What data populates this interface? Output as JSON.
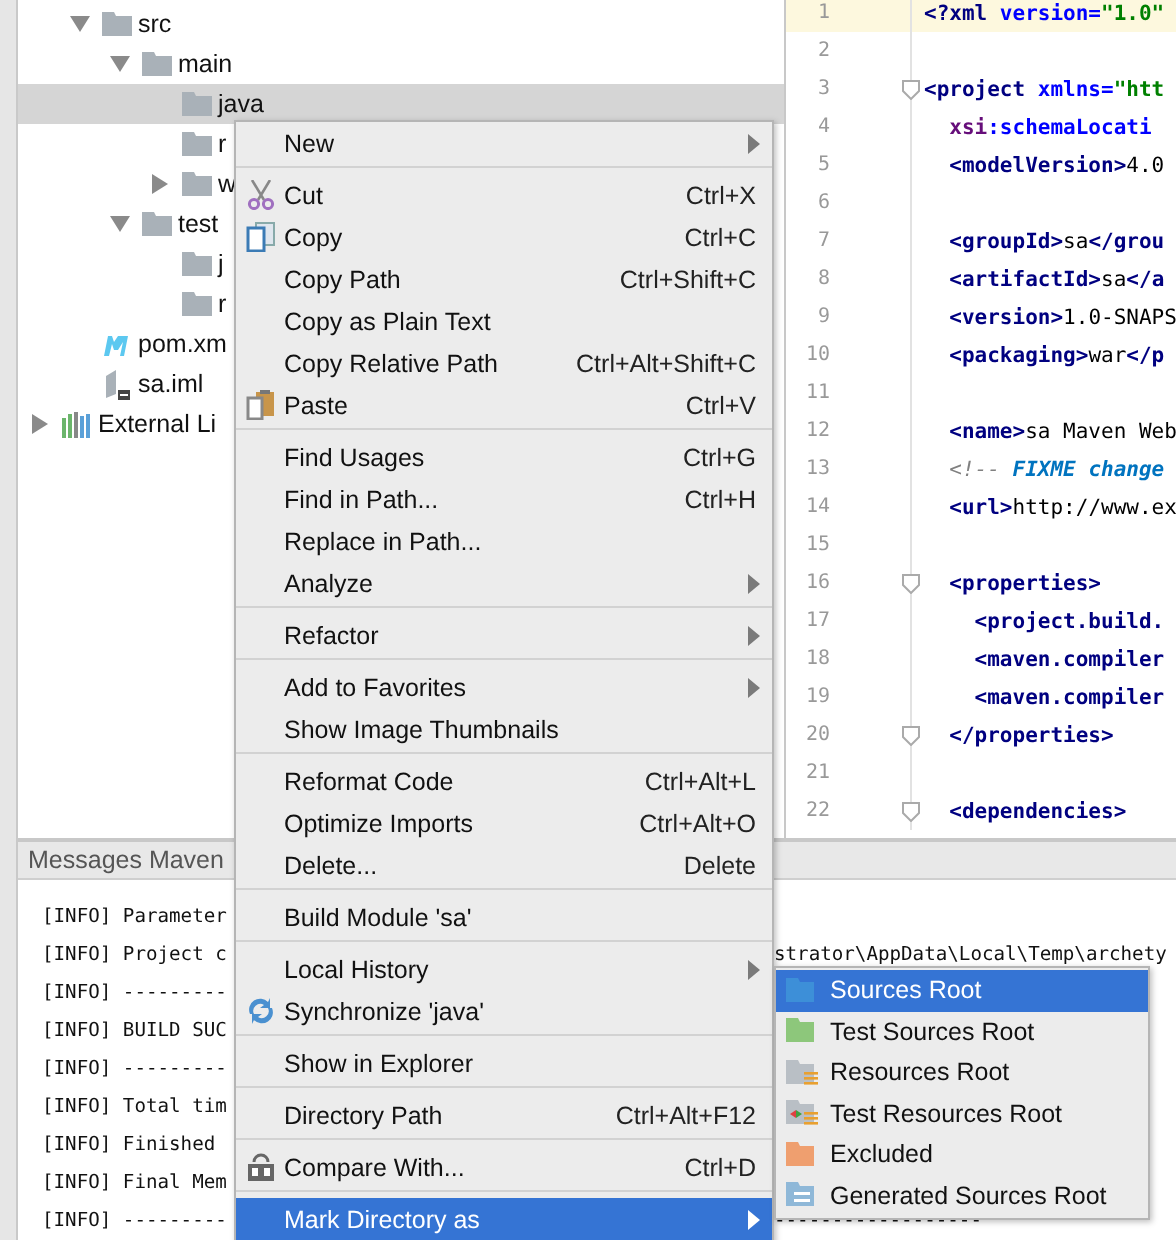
{
  "tree": {
    "items": [
      {
        "label": "src",
        "kind": "folder",
        "expanded": true,
        "selected": false,
        "children": [
          {
            "label": "main",
            "kind": "folder",
            "expanded": true,
            "selected": false,
            "children": [
              {
                "label": "java",
                "kind": "folder",
                "selected": true
              },
              {
                "label": "r",
                "kind": "folder",
                "selected": false
              },
              {
                "label": "w",
                "kind": "folder",
                "expanded": false,
                "selected": false
              }
            ]
          },
          {
            "label": "test",
            "kind": "folder",
            "expanded": true,
            "selected": false,
            "children": [
              {
                "label": "j",
                "kind": "folder",
                "selected": false
              },
              {
                "label": "r",
                "kind": "folder",
                "selected": false
              }
            ]
          }
        ]
      },
      {
        "label": "pom.xm",
        "kind": "maven",
        "selected": false
      },
      {
        "label": "sa.iml",
        "kind": "module",
        "selected": false
      }
    ],
    "root_items": [
      {
        "label": "External Li",
        "kind": "library",
        "expanded": false,
        "selected": false
      }
    ]
  },
  "editor": {
    "lines": [
      {
        "number": "1",
        "current": true,
        "fold": false,
        "segments": [
          {
            "text": "<?xml",
            "kind": "tag"
          },
          {
            "text": " version=",
            "kind": "attr"
          },
          {
            "text": "\"1.0\"",
            "kind": "string"
          }
        ]
      },
      {
        "number": "2",
        "current": false,
        "fold": false
      },
      {
        "number": "3",
        "current": false,
        "fold": true,
        "segments": [
          {
            "text": "<project",
            "kind": "tag"
          },
          {
            "text": " xmlns=",
            "kind": "attr"
          },
          {
            "text": "\"htt",
            "kind": "string"
          }
        ]
      },
      {
        "number": "4",
        "current": false,
        "fold": false,
        "segments": [
          {
            "text": "  xsi",
            "kind": "ns"
          },
          {
            "text": ":schemaLocati",
            "kind": "attr"
          }
        ]
      },
      {
        "number": "5",
        "current": false,
        "fold": false,
        "segments": [
          {
            "text": "  <modelVersion>",
            "kind": "tag"
          },
          {
            "text": "4.0",
            "kind": "text"
          }
        ]
      },
      {
        "number": "6",
        "current": false,
        "fold": false
      },
      {
        "number": "7",
        "current": false,
        "fold": false,
        "segments": [
          {
            "text": "  <groupId>",
            "kind": "tag"
          },
          {
            "text": "sa",
            "kind": "text"
          },
          {
            "text": "</grou",
            "kind": "tag"
          }
        ]
      },
      {
        "number": "8",
        "current": false,
        "fold": false,
        "segments": [
          {
            "text": "  <artifactId>",
            "kind": "tag"
          },
          {
            "text": "sa",
            "kind": "text"
          },
          {
            "text": "</a",
            "kind": "tag"
          }
        ]
      },
      {
        "number": "9",
        "current": false,
        "fold": false,
        "segments": [
          {
            "text": "  <version>",
            "kind": "tag"
          },
          {
            "text": "1.0-SNAPS",
            "kind": "text"
          }
        ]
      },
      {
        "number": "10",
        "current": false,
        "fold": false,
        "segments": [
          {
            "text": "  <packaging>",
            "kind": "tag"
          },
          {
            "text": "war",
            "kind": "text"
          },
          {
            "text": "</p",
            "kind": "tag"
          }
        ]
      },
      {
        "number": "11",
        "current": false,
        "fold": false
      },
      {
        "number": "12",
        "current": false,
        "fold": false,
        "segments": [
          {
            "text": "  <name>",
            "kind": "tag"
          },
          {
            "text": "sa Maven Web",
            "kind": "text"
          }
        ]
      },
      {
        "number": "13",
        "current": false,
        "fold": false,
        "segments": [
          {
            "text": "  <!-- ",
            "kind": "comment"
          },
          {
            "text": "FIXME change",
            "kind": "todo"
          }
        ]
      },
      {
        "number": "14",
        "current": false,
        "fold": false,
        "segments": [
          {
            "text": "  <url>",
            "kind": "tag"
          },
          {
            "text": "http://www.ex",
            "kind": "text"
          }
        ]
      },
      {
        "number": "15",
        "current": false,
        "fold": false
      },
      {
        "number": "16",
        "current": false,
        "fold": true,
        "segments": [
          {
            "text": "  <properties>",
            "kind": "tag"
          }
        ]
      },
      {
        "number": "17",
        "current": false,
        "fold": false,
        "segments": [
          {
            "text": "    <project.build.",
            "kind": "tag"
          }
        ]
      },
      {
        "number": "18",
        "current": false,
        "fold": false,
        "segments": [
          {
            "text": "    <maven.compiler",
            "kind": "tag"
          }
        ]
      },
      {
        "number": "19",
        "current": false,
        "fold": false,
        "segments": [
          {
            "text": "    <maven.compiler",
            "kind": "tag"
          }
        ]
      },
      {
        "number": "20",
        "current": false,
        "fold": true,
        "segments": [
          {
            "text": "  </properties>",
            "kind": "tag"
          }
        ]
      },
      {
        "number": "21",
        "current": false,
        "fold": false
      },
      {
        "number": "22",
        "current": false,
        "fold": true,
        "segments": [
          {
            "text": "  <dependencies>",
            "kind": "tag"
          }
        ]
      }
    ]
  },
  "bottom_panel": {
    "tab": "Messages Maven",
    "lines": [
      {
        "text": "[INFO] Parameter"
      },
      {
        "text": "[INFO] Project c",
        "tail": "strator\\AppData\\Local\\Temp\\archety"
      },
      {
        "text": "[INFO] ---------"
      },
      {
        "text": "[INFO] BUILD SUC"
      },
      {
        "text": "[INFO] ---------"
      },
      {
        "text": "[INFO] Total tim"
      },
      {
        "text": "[INFO] Finished"
      },
      {
        "text": "[INFO] Final Mem"
      },
      {
        "text": "[INFO] ---------",
        "tail": "------------------"
      }
    ]
  },
  "context_menu": {
    "groups": [
      [
        {
          "label": "New",
          "has_submenu": true,
          "selected": false
        }
      ],
      [
        {
          "label": "Cut",
          "shortcut": "Ctrl+X",
          "has_submenu": false,
          "selected": false
        },
        {
          "label": "Copy",
          "shortcut": "Ctrl+C",
          "has_submenu": false,
          "selected": false
        },
        {
          "label": "Copy Path",
          "shortcut": "Ctrl+Shift+C",
          "has_submenu": false,
          "selected": false
        },
        {
          "label": "Copy as Plain Text",
          "has_submenu": false,
          "selected": false
        },
        {
          "label": "Copy Relative Path",
          "shortcut": "Ctrl+Alt+Shift+C",
          "has_submenu": false,
          "selected": false
        },
        {
          "label": "Paste",
          "shortcut": "Ctrl+V",
          "has_submenu": false,
          "selected": false
        }
      ],
      [
        {
          "label": "Find Usages",
          "shortcut": "Ctrl+G",
          "has_submenu": false,
          "selected": false
        },
        {
          "label": "Find in Path...",
          "shortcut": "Ctrl+H",
          "has_submenu": false,
          "selected": false
        },
        {
          "label": "Replace in Path...",
          "has_submenu": false,
          "selected": false
        },
        {
          "label": "Analyze",
          "has_submenu": true,
          "selected": false
        }
      ],
      [
        {
          "label": "Refactor",
          "has_submenu": true,
          "selected": false
        }
      ],
      [
        {
          "label": "Add to Favorites",
          "has_submenu": true,
          "selected": false
        },
        {
          "label": "Show Image Thumbnails",
          "has_submenu": false,
          "selected": false
        }
      ],
      [
        {
          "label": "Reformat Code",
          "shortcut": "Ctrl+Alt+L",
          "has_submenu": false,
          "selected": false
        },
        {
          "label": "Optimize Imports",
          "shortcut": "Ctrl+Alt+O",
          "has_submenu": false,
          "selected": false
        },
        {
          "label": "Delete...",
          "shortcut": "Delete",
          "has_submenu": false,
          "selected": false
        }
      ],
      [
        {
          "label": "Build Module 'sa'",
          "has_submenu": false,
          "selected": false
        }
      ],
      [
        {
          "label": "Local History",
          "has_submenu": true,
          "selected": false
        },
        {
          "label": "Synchronize 'java'",
          "has_submenu": false,
          "selected": false
        }
      ],
      [
        {
          "label": "Show in Explorer",
          "has_submenu": false,
          "selected": false
        }
      ],
      [
        {
          "label": "Directory Path",
          "shortcut": "Ctrl+Alt+F12",
          "has_submenu": false,
          "selected": false
        }
      ],
      [
        {
          "label": "Compare With...",
          "shortcut": "Ctrl+D",
          "has_submenu": false,
          "selected": false
        }
      ],
      [
        {
          "label": "Mark Directory as",
          "has_submenu": true,
          "selected": true
        }
      ]
    ]
  },
  "submenu": {
    "items": [
      {
        "label": "Sources Root",
        "kind": "plain",
        "color": "#3d8fd8",
        "selected": true
      },
      {
        "label": "Test Sources Root",
        "kind": "plain",
        "color": "#8dc77b",
        "selected": false
      },
      {
        "label": "Resources Root",
        "kind": "resources",
        "color": "#b9bfc5",
        "selected": false
      },
      {
        "label": "Test Resources Root",
        "kind": "test-resources",
        "color": "#b9bfc5",
        "selected": false
      },
      {
        "label": "Excluded",
        "kind": "plain",
        "color": "#ef9f6f",
        "selected": false
      },
      {
        "label": "Generated Sources Root",
        "kind": "generated",
        "color": "#8fb8d8",
        "selected": false
      }
    ]
  }
}
